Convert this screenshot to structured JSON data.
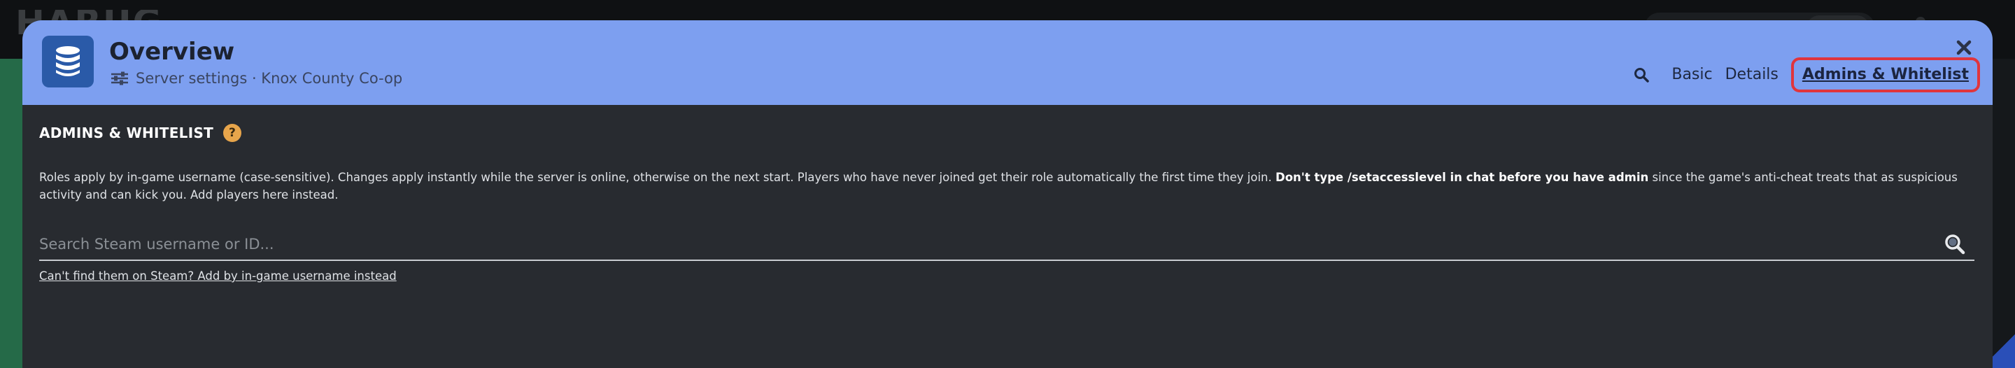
{
  "background": {
    "logo_text": "HARUG"
  },
  "header": {
    "title": "Overview",
    "subtitle": "Server settings · Knox County Co-op",
    "tabs": [
      {
        "label": "Basic",
        "active": false
      },
      {
        "label": "Details",
        "active": false
      },
      {
        "label": "Admins & Whitelist",
        "active": true
      }
    ],
    "icons": {
      "app": "database-stack-icon",
      "subtitle": "sliders-icon",
      "search": "search-icon",
      "close": "close-icon"
    }
  },
  "section": {
    "title": "ADMINS & WHITELIST",
    "help_glyph": "?",
    "description_part1": "Roles apply by in-game username (case-sensitive). Changes apply instantly while the server is online, otherwise on the next start. Players who have never joined get their role automatically the first time they join. ",
    "description_bold": "Don't type /setaccesslevel in chat before you have admin",
    "description_part2": " since the game's anti-cheat treats that as suspicious activity and can kick you. Add players here instead."
  },
  "search": {
    "placeholder": "Search Steam username or ID...",
    "value": ""
  },
  "alt_link": "Can't find them on Steam? Add by in-game username instead",
  "colors": {
    "header_bg": "#7d9ff0",
    "modal_bg": "#282b30",
    "active_tab_outline": "#e0353d",
    "help_badge": "#e7a54b",
    "app_icon_bg": "#2a5aa8"
  }
}
